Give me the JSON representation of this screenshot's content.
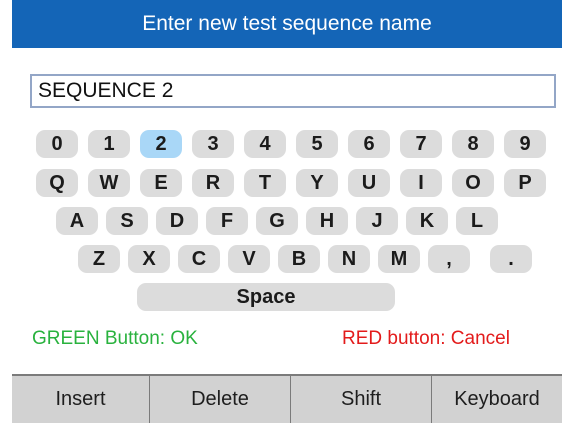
{
  "title": "Enter new test sequence name",
  "input": {
    "value": "SEQUENCE 2"
  },
  "keyboard": {
    "row1": [
      "0",
      "1",
      "2",
      "3",
      "4",
      "5",
      "6",
      "7",
      "8",
      "9"
    ],
    "row2": [
      "Q",
      "W",
      "E",
      "R",
      "T",
      "Y",
      "U",
      "I",
      "O",
      "P"
    ],
    "row3": [
      "A",
      "S",
      "D",
      "F",
      "G",
      "H",
      "J",
      "K",
      "L"
    ],
    "row4": [
      "Z",
      "X",
      "C",
      "V",
      "B",
      "N",
      "M",
      ",",
      "."
    ],
    "space": "Space",
    "selected_key": "2"
  },
  "status": {
    "ok": "GREEN Button: OK",
    "cancel": "RED button: Cancel"
  },
  "softkeys": [
    "Insert",
    "Delete",
    "Shift",
    "Keyboard"
  ],
  "colors": {
    "title_bar": "#1465b7",
    "key": "#dcdcdc",
    "key_selected": "#a9d7f7",
    "ok_text": "#29b23e",
    "cancel_text": "#e31b1b",
    "softkey_bar": "#d2d2d2"
  }
}
